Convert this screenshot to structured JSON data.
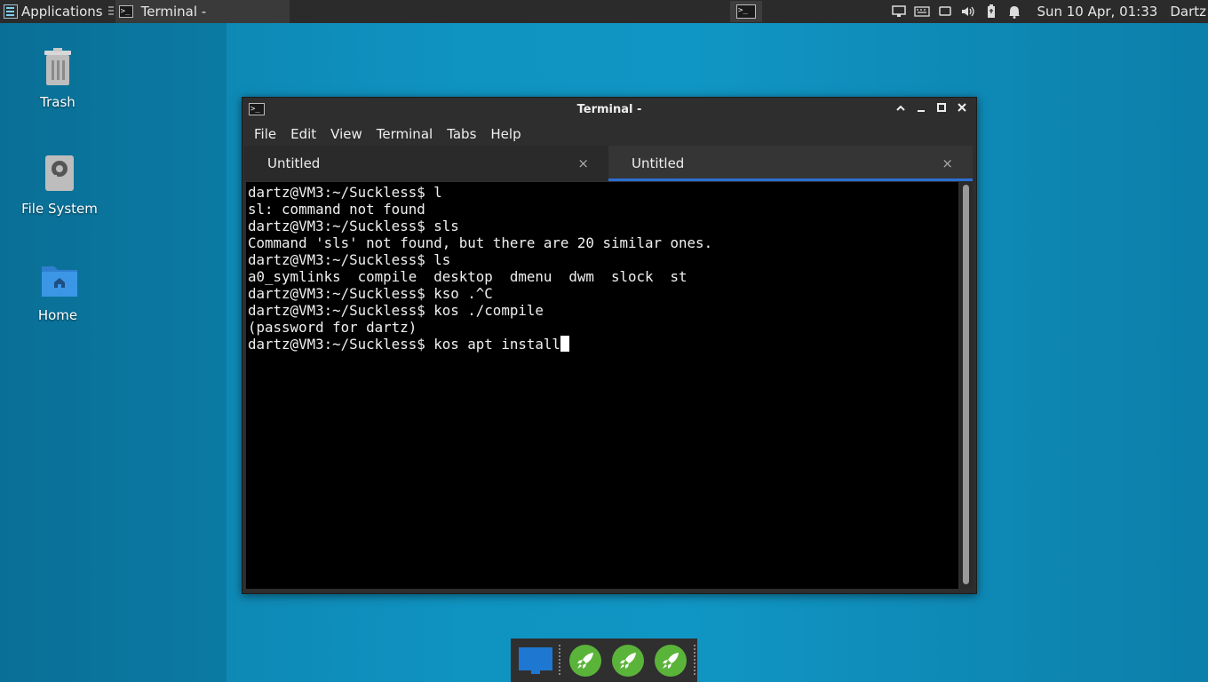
{
  "top_panel": {
    "applications_label": "Applications",
    "task_title": "Terminal -",
    "clock": "Sun 10 Apr, 01:33",
    "user": "Dartz",
    "tray_icons": [
      "network-icon",
      "keyboard-icon",
      "display-icon",
      "volume-icon",
      "battery-icon",
      "bell-icon"
    ]
  },
  "desktop": {
    "icons": [
      {
        "label": "Trash",
        "icon": "trash-icon"
      },
      {
        "label": "File System",
        "icon": "drive-icon"
      },
      {
        "label": "Home",
        "icon": "home-folder-icon"
      }
    ]
  },
  "window": {
    "title": "Terminal -",
    "menu": [
      "File",
      "Edit",
      "View",
      "Terminal",
      "Tabs",
      "Help"
    ],
    "tabs": [
      {
        "label": "Untitled",
        "active": false
      },
      {
        "label": "Untitled",
        "active": true
      }
    ],
    "terminal_lines": [
      "dartz@VM3:~/Suckless$ l",
      "sl: command not found",
      "dartz@VM3:~/Suckless$ sls",
      "Command 'sls' not found, but there are 20 similar ones.",
      "dartz@VM3:~/Suckless$ ls",
      "a0_symlinks  compile  desktop  dmenu  dwm  slock  st",
      "dartz@VM3:~/Suckless$ kso .^C",
      "dartz@VM3:~/Suckless$ kos ./compile",
      "(password for dartz)"
    ],
    "current_prompt": "dartz@VM3:~/Suckless$ kos apt install"
  },
  "colors": {
    "accent": "#2a6fd1",
    "desktop_bg": "#0f8cb9",
    "panel_bg": "#2b2b2b",
    "launcher_green": "#5bb43a"
  }
}
